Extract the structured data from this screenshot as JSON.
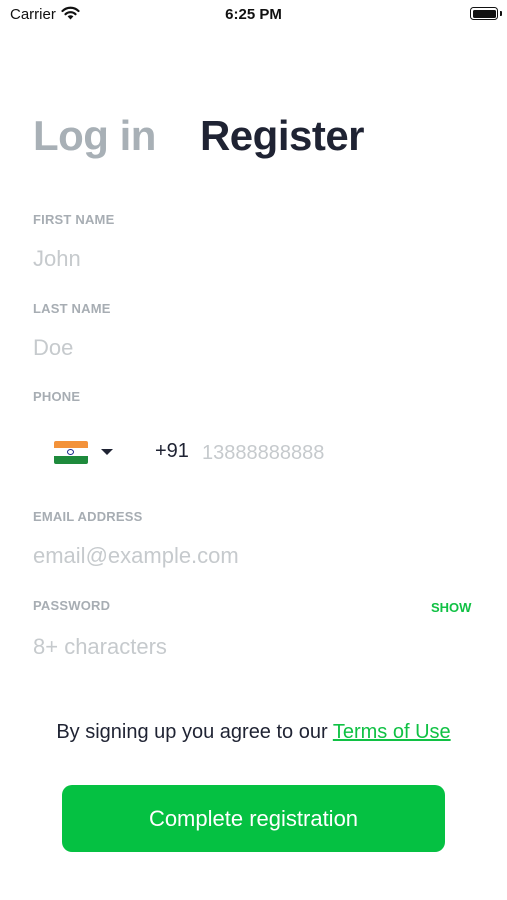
{
  "status_bar": {
    "carrier": "Carrier",
    "time": "6:25 PM",
    "icons": [
      "wifi-icon",
      "battery-icon"
    ]
  },
  "tabs": {
    "login_label": "Log in",
    "register_label": "Register",
    "active": "Register"
  },
  "form": {
    "first_name": {
      "label": "FIRST NAME",
      "value": "",
      "placeholder": "John"
    },
    "last_name": {
      "label": "LAST NAME",
      "value": "",
      "placeholder": "Doe"
    },
    "phone": {
      "label": "PHONE",
      "country_icon": "india-flag-icon",
      "dial_code": "+91",
      "value": "",
      "placeholder": "13888888888"
    },
    "email": {
      "label": "EMAIL ADDRESS",
      "value": "",
      "placeholder": "email@example.com"
    },
    "password": {
      "label": "PASSWORD",
      "value": "",
      "placeholder": "8+ characters",
      "show_label": "SHOW"
    }
  },
  "terms": {
    "prefix": "By signing up you agree to our ",
    "link": "Terms of Use"
  },
  "submit_label": "Complete registration",
  "colors": {
    "accent": "#05c142",
    "link": "#10c144",
    "text_dark": "#1f2333",
    "label_gray": "#a7adb3",
    "placeholder_gray": "#c6cacd",
    "inactive_tab": "#a8b0b6"
  }
}
